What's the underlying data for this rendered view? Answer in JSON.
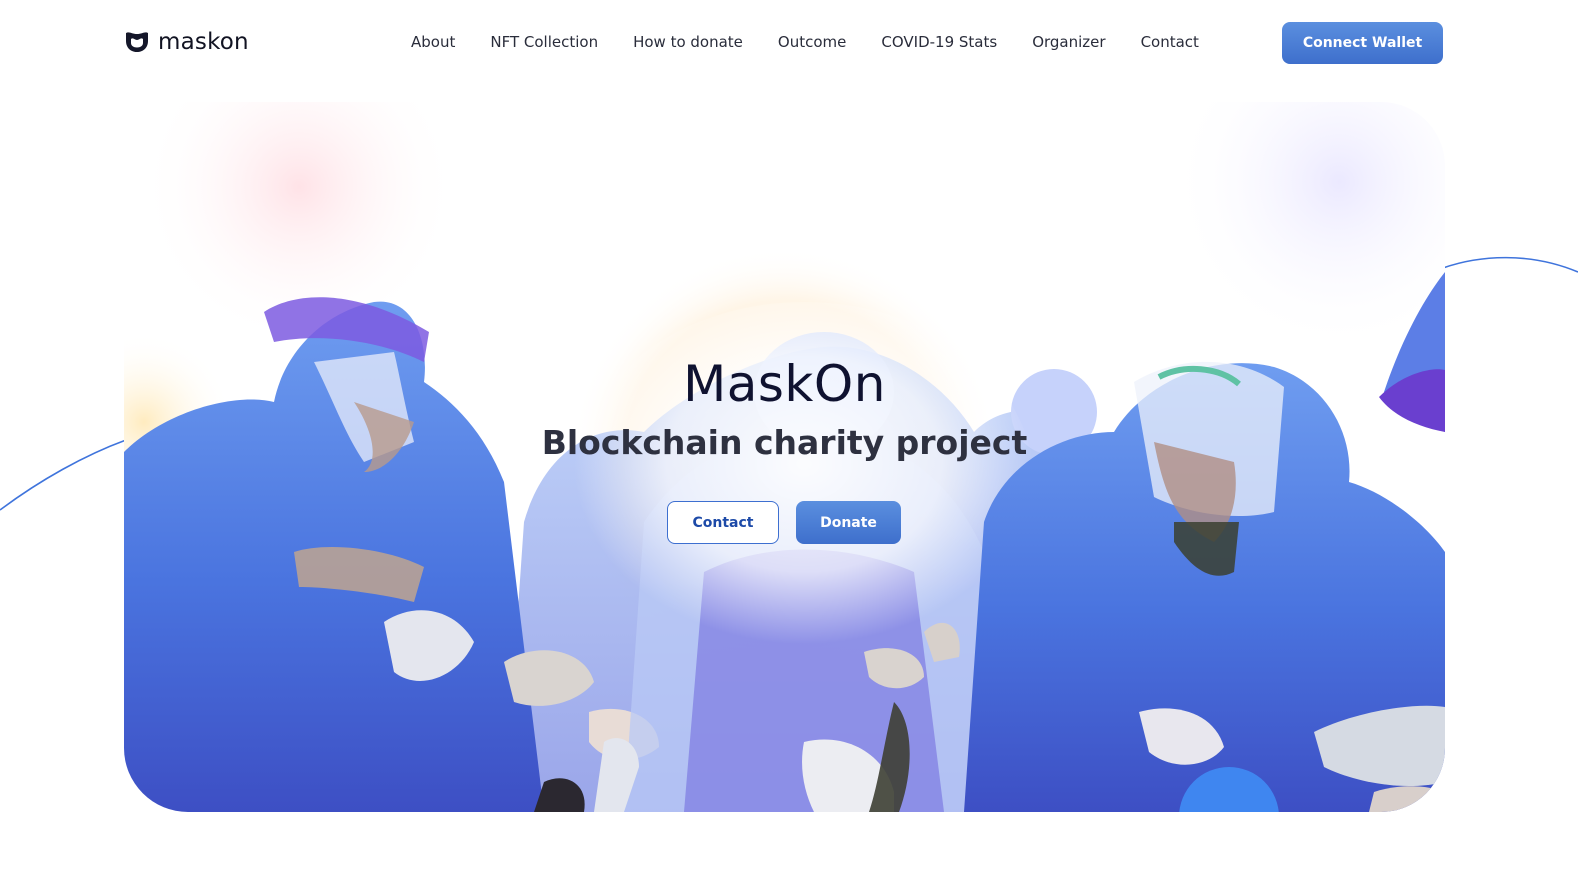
{
  "brand": {
    "name": "maskon",
    "logo_icon": "mask-icon"
  },
  "nav": {
    "items": [
      {
        "label": "About"
      },
      {
        "label": "NFT Collection"
      },
      {
        "label": "How to donate"
      },
      {
        "label": "Outcome"
      },
      {
        "label": "COVID-19 Stats"
      },
      {
        "label": "Organizer"
      },
      {
        "label": "Contact"
      }
    ],
    "connect_label": "Connect Wallet"
  },
  "hero": {
    "title": "MaskOn",
    "subtitle": "Blockchain charity project",
    "contact_label": "Contact",
    "donate_label": "Donate",
    "illustration": "medical-workers-illustration"
  },
  "colors": {
    "accent": "#3e6fcc",
    "accent_light": "#5b8fdf",
    "text_dark": "#0f1230",
    "deco_line": "#3f74dc"
  }
}
